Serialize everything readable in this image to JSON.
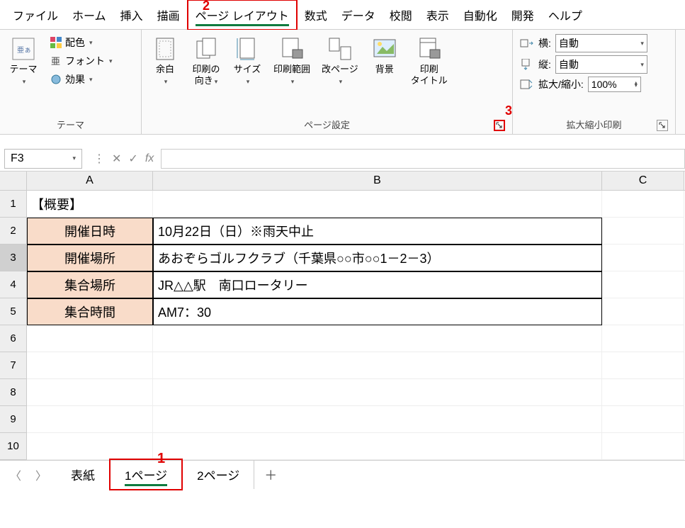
{
  "menu": {
    "items": [
      "ファイル",
      "ホーム",
      "挿入",
      "描画",
      "ページ レイアウト",
      "数式",
      "データ",
      "校閲",
      "表示",
      "自動化",
      "開発",
      "ヘルプ"
    ],
    "active_index": 4
  },
  "annotations": {
    "a1": "1",
    "a2": "2",
    "a3": "3"
  },
  "ribbon": {
    "theme_group": {
      "label": "テーマ",
      "themes_btn": "テーマ",
      "colors": "配色",
      "fonts": "フォント",
      "effects": "効果"
    },
    "page_setup_group": {
      "label": "ページ設定",
      "margins": "余白",
      "orientation": "印刷の\n向き",
      "size": "サイズ",
      "print_area": "印刷範囲",
      "breaks": "改ページ",
      "background": "背景",
      "print_titles": "印刷\nタイトル"
    },
    "scale_group": {
      "label": "拡大縮小印刷",
      "width_label": "横:",
      "width_value": "自動",
      "height_label": "縦:",
      "height_value": "自動",
      "scale_label": "拡大/縮小:",
      "scale_value": "100%"
    }
  },
  "formula_bar": {
    "name_box": "F3",
    "fx": "fx",
    "value": ""
  },
  "grid": {
    "columns": [
      "A",
      "B",
      "C"
    ],
    "rows": [
      {
        "n": 1,
        "A": "【概要】",
        "B": ""
      },
      {
        "n": 2,
        "A": "開催日時",
        "B": "10月22日（日）※雨天中止",
        "hdr": true
      },
      {
        "n": 3,
        "A": "開催場所",
        "B": "あおぞらゴルフクラブ（千葉県○○市○○1－2－3）",
        "hdr": true,
        "sel": true
      },
      {
        "n": 4,
        "A": "集合場所",
        "B": "JR△△駅　南口ロータリー",
        "hdr": true
      },
      {
        "n": 5,
        "A": "集合時間",
        "B": "AM7：30",
        "hdr": true
      },
      {
        "n": 6,
        "A": "",
        "B": ""
      },
      {
        "n": 7,
        "A": "",
        "B": ""
      },
      {
        "n": 8,
        "A": "",
        "B": ""
      },
      {
        "n": 9,
        "A": "",
        "B": ""
      },
      {
        "n": 10,
        "A": "",
        "B": ""
      }
    ]
  },
  "tabs": {
    "items": [
      "表紙",
      "1ページ",
      "2ページ"
    ],
    "active_index": 1,
    "add": "＋"
  }
}
